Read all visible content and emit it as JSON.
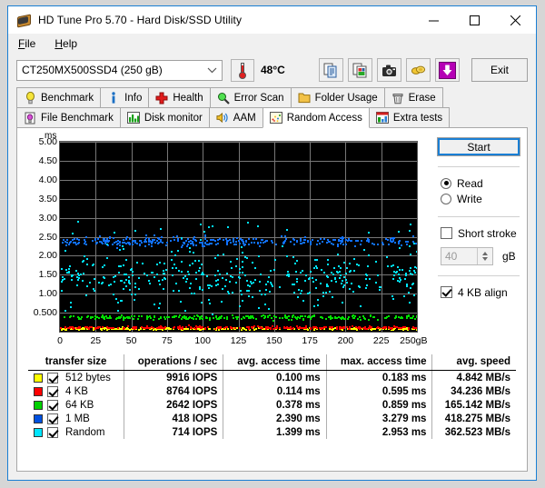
{
  "window": {
    "title": "HD Tune Pro 5.70 - Hard Disk/SSD Utility",
    "app_icon": "hard-disk-icon",
    "minimize": "minimize-icon",
    "maximize": "maximize-icon",
    "close": "close-icon"
  },
  "menu": {
    "items": [
      "File",
      "Help"
    ]
  },
  "toolbar": {
    "drive": "CT250MX500SSD4 (250 gB)",
    "drive_chevron": "chevron-down-icon",
    "temperature": "48°C",
    "thermometer_icon": "thermometer-icon",
    "buttons": [
      {
        "name": "copy-text-icon"
      },
      {
        "name": "copy-image-icon"
      },
      {
        "name": "screenshot-camera-icon"
      },
      {
        "name": "coins-icon"
      },
      {
        "name": "download-arrow-icon"
      }
    ],
    "exit_label": "Exit"
  },
  "tabs": {
    "row1": [
      {
        "label": "Benchmark",
        "icon": "lightbulb-icon",
        "active": false
      },
      {
        "label": "Info",
        "icon": "info-icon",
        "active": false
      },
      {
        "label": "Health",
        "icon": "red-cross-icon",
        "active": false
      },
      {
        "label": "Error Scan",
        "icon": "magnifier-icon",
        "active": false
      },
      {
        "label": "Folder Usage",
        "icon": "folder-icon",
        "active": false
      },
      {
        "label": "Erase",
        "icon": "trash-icon",
        "active": false
      }
    ],
    "row2": [
      {
        "label": "File Benchmark",
        "icon": "file-benchmark-icon",
        "active": false
      },
      {
        "label": "Disk monitor",
        "icon": "bar-chart-icon",
        "active": false
      },
      {
        "label": "AAM",
        "icon": "speaker-icon",
        "active": false
      },
      {
        "label": "Random Access",
        "icon": "random-access-icon",
        "active": true
      },
      {
        "label": "Extra tests",
        "icon": "extra-tests-icon",
        "active": false
      }
    ]
  },
  "controls": {
    "start_label": "Start",
    "mode": {
      "read_label": "Read",
      "write_label": "Write",
      "selected": "Read"
    },
    "short_stroke": {
      "label": "Short stroke",
      "checked": false,
      "value": "40",
      "unit": "gB"
    },
    "align": {
      "label": "4 KB align",
      "checked": true
    }
  },
  "chart_data": {
    "type": "scatter",
    "title": "",
    "xlabel": "gB",
    "ylabel": "ms",
    "xlim": [
      0,
      250
    ],
    "ylim": [
      0,
      5.0
    ],
    "grid": true,
    "xticks": [
      "0",
      "25",
      "50",
      "75",
      "100",
      "125",
      "150",
      "175",
      "200",
      "225",
      "250gB"
    ],
    "xtick_values": [
      0,
      25,
      50,
      75,
      100,
      125,
      150,
      175,
      200,
      225,
      250
    ],
    "yticks": [
      "0.500",
      "1.00",
      "1.50",
      "2.00",
      "2.50",
      "3.00",
      "3.50",
      "4.00",
      "4.50",
      "5.00"
    ],
    "ytick_values": [
      0.5,
      1.0,
      1.5,
      2.0,
      2.5,
      3.0,
      3.5,
      4.0,
      4.5,
      5.0
    ],
    "plot_background": "#000000",
    "grid_color": "#777777",
    "series": [
      {
        "name": "512 bytes",
        "color": "#ffff00",
        "center_ms": 0.1,
        "spread_ms": 0.05,
        "count": 260
      },
      {
        "name": "4 KB",
        "color": "#ff0000",
        "center_ms": 0.13,
        "spread_ms": 0.06,
        "count": 260
      },
      {
        "name": "64 KB",
        "color": "#00e000",
        "center_ms": 0.4,
        "spread_ms": 0.1,
        "count": 250
      },
      {
        "name": "1 MB",
        "color": "#1070ff",
        "center_ms": 2.4,
        "spread_ms": 0.22,
        "count": 330
      },
      {
        "name": "Random",
        "color": "#00e5ff",
        "center_ms": 1.45,
        "spread_ms": 0.95,
        "count": 430
      }
    ]
  },
  "results": {
    "headers": [
      "transfer size",
      "operations / sec",
      "avg. access time",
      "max. access time",
      "avg. speed"
    ],
    "rows": [
      {
        "color": "#ffff00",
        "checked": true,
        "size": "512 bytes",
        "ops": "9916 IOPS",
        "avg_access": "0.100 ms",
        "max_access": "0.183 ms",
        "avg_speed": "4.842 MB/s"
      },
      {
        "color": "#ff0000",
        "checked": true,
        "size": "4 KB",
        "ops": "8764 IOPS",
        "avg_access": "0.114 ms",
        "max_access": "0.595 ms",
        "avg_speed": "34.236 MB/s"
      },
      {
        "color": "#00d000",
        "checked": true,
        "size": "64 KB",
        "ops": "2642 IOPS",
        "avg_access": "0.378 ms",
        "max_access": "0.859 ms",
        "avg_speed": "165.142 MB/s"
      },
      {
        "color": "#0050e0",
        "checked": true,
        "size": "1 MB",
        "ops": "418 IOPS",
        "avg_access": "2.390 ms",
        "max_access": "3.279 ms",
        "avg_speed": "418.275 MB/s"
      },
      {
        "color": "#00e5ff",
        "checked": true,
        "size": "Random",
        "ops": "714 IOPS",
        "avg_access": "1.399 ms",
        "max_access": "2.953 ms",
        "avg_speed": "362.523 MB/s"
      }
    ]
  }
}
